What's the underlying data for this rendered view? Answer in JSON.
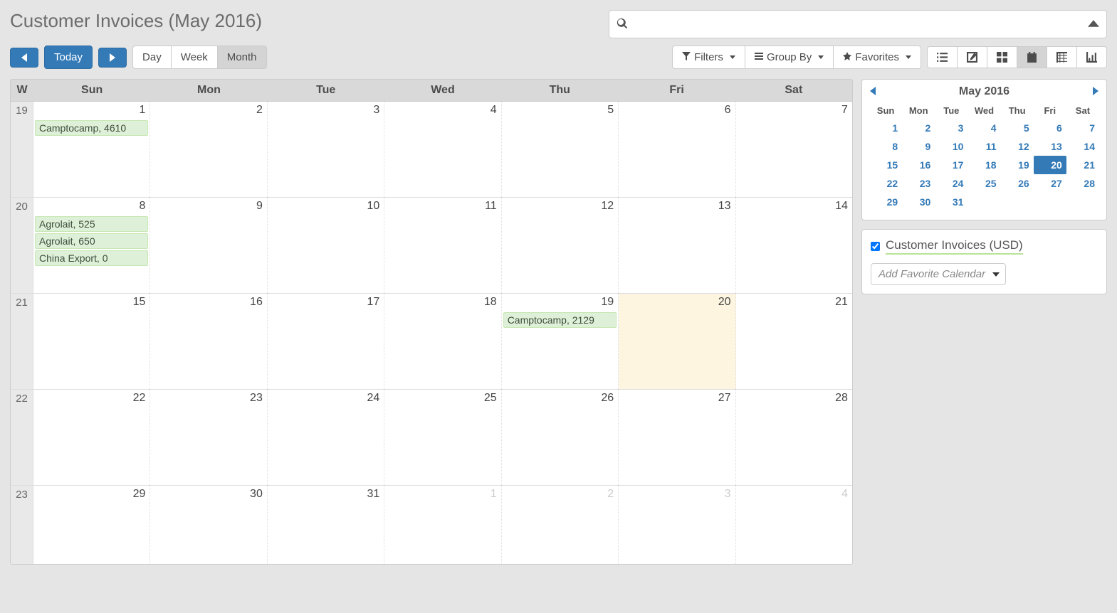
{
  "title": "Customer Invoices (May 2016)",
  "search": {
    "placeholder": ""
  },
  "nav": {
    "today": "Today",
    "day": "Day",
    "week": "Week",
    "month": "Month"
  },
  "filters": {
    "filters": "Filters",
    "groupby": "Group By",
    "favorites": "Favorites"
  },
  "calendar": {
    "headers": [
      "W",
      "Sun",
      "Mon",
      "Tue",
      "Wed",
      "Thu",
      "Fri",
      "Sat"
    ],
    "weeks": [
      {
        "wk": "19",
        "days": [
          {
            "n": "1",
            "events": [
              "Camptocamp, 4610"
            ]
          },
          {
            "n": "2"
          },
          {
            "n": "3"
          },
          {
            "n": "4"
          },
          {
            "n": "5"
          },
          {
            "n": "6"
          },
          {
            "n": "7"
          }
        ]
      },
      {
        "wk": "20",
        "days": [
          {
            "n": "8",
            "events": [
              "Agrolait, 525",
              "Agrolait, 650",
              "China Export, 0"
            ]
          },
          {
            "n": "9"
          },
          {
            "n": "10"
          },
          {
            "n": "11"
          },
          {
            "n": "12"
          },
          {
            "n": "13"
          },
          {
            "n": "14"
          }
        ]
      },
      {
        "wk": "21",
        "days": [
          {
            "n": "15"
          },
          {
            "n": "16"
          },
          {
            "n": "17"
          },
          {
            "n": "18"
          },
          {
            "n": "19",
            "events": [
              "Camptocamp, 2129"
            ]
          },
          {
            "n": "20",
            "today": true
          },
          {
            "n": "21"
          }
        ]
      },
      {
        "wk": "22",
        "days": [
          {
            "n": "22"
          },
          {
            "n": "23"
          },
          {
            "n": "24"
          },
          {
            "n": "25"
          },
          {
            "n": "26"
          },
          {
            "n": "27"
          },
          {
            "n": "28"
          }
        ]
      },
      {
        "wk": "23",
        "days": [
          {
            "n": "29"
          },
          {
            "n": "30"
          },
          {
            "n": "31"
          },
          {
            "n": "1",
            "other": true
          },
          {
            "n": "2",
            "other": true
          },
          {
            "n": "3",
            "other": true
          },
          {
            "n": "4",
            "other": true
          }
        ]
      }
    ]
  },
  "mini": {
    "title": "May 2016",
    "dow": [
      "Sun",
      "Mon",
      "Tue",
      "Wed",
      "Thu",
      "Fri",
      "Sat"
    ],
    "rows": [
      [
        "1",
        "2",
        "3",
        "4",
        "5",
        "6",
        "7"
      ],
      [
        "8",
        "9",
        "10",
        "11",
        "12",
        "13",
        "14"
      ],
      [
        "15",
        "16",
        "17",
        "18",
        "19",
        "20",
        "21"
      ],
      [
        "22",
        "23",
        "24",
        "25",
        "26",
        "27",
        "28"
      ],
      [
        "29",
        "30",
        "31",
        "",
        "",
        "",
        ""
      ]
    ],
    "selected": "20"
  },
  "sidebar": {
    "filter_label": "Customer Invoices (USD)",
    "fav_placeholder": "Add Favorite Calendar"
  }
}
